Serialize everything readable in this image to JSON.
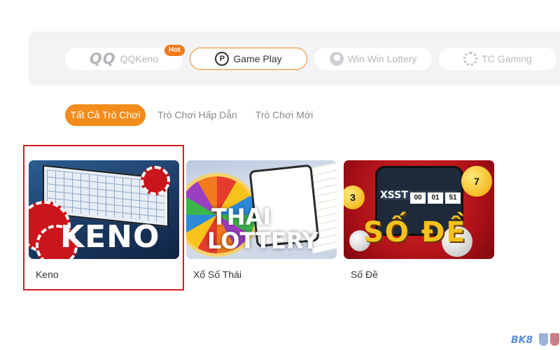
{
  "providers": [
    {
      "logo": "QQ",
      "label": "QQKeno",
      "badge": "Hot",
      "icon": "qq-logo",
      "active": false
    },
    {
      "label": "Game Play",
      "icon": "game-play-icon",
      "active": true
    },
    {
      "label": "Win Win Lottery",
      "icon": "win-win-icon",
      "active": false
    },
    {
      "label": "TC Gaming",
      "icon": "tc-gaming-icon",
      "active": false
    }
  ],
  "categories": [
    {
      "label": "Tất Cả Trò Chơi",
      "active": true
    },
    {
      "label": "Trò Chơi Hấp Dẫn",
      "active": false
    },
    {
      "label": "Trò Chơi Mới",
      "active": false
    }
  ],
  "games": [
    {
      "name": "Keno",
      "thumb_text": "KENO",
      "highlighted": true
    },
    {
      "name": "Xổ Số Thái",
      "thumb_text": [
        "THAI",
        "LOTTERY"
      ]
    },
    {
      "name": "Số Đề",
      "thumb_text": "SỐ ĐỀ",
      "screen_text": "XSST",
      "screen_numbers": [
        "00",
        "01",
        "51"
      ],
      "ball_numbers": [
        "3",
        "7"
      ]
    }
  ],
  "watermark": "BK8",
  "colors": {
    "accent": "#f38c1a",
    "highlight_border": "#d11f1f",
    "hot_badge": "#f47a1a"
  }
}
